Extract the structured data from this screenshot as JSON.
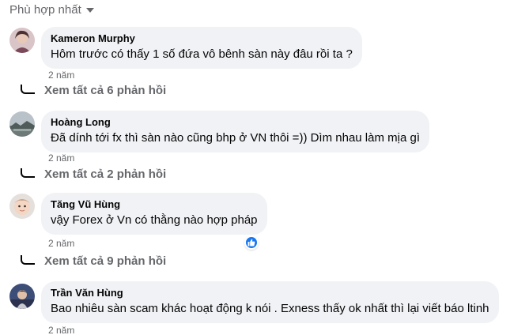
{
  "sort_label": "Phù hợp nhất",
  "comments": [
    {
      "author": "Kameron Murphy",
      "text": "Hôm trước có thấy 1 số đứa vô bênh sàn này đâu rồi ta ?",
      "time": "2 năm",
      "replies": "Xem tất cả 6 phản hồi"
    },
    {
      "author": "Hoàng Long",
      "text": "Đã dính tới fx thì sàn nào cũng bhp ở VN thôi =)) Dìm nhau làm mịa gì",
      "time": "2 năm",
      "replies": "Xem tất cả 2 phản hồi"
    },
    {
      "author": "Tăng Vũ Hùng",
      "text": "vậy Forex ở Vn có thằng nào hợp pháp",
      "time": "2 năm",
      "replies": "Xem tất cả 9 phản hồi"
    },
    {
      "author": "Trần Văn Hùng",
      "text": "Bao nhiêu sàn scam khác hoạt động k nói . Exness thấy ok nhất thì lại viết báo ltinh",
      "time": "2 năm"
    }
  ],
  "icons": {
    "sort": "chevron-down-icon",
    "like": "thumbs-up-icon",
    "reply_connector": "reply-connector-icon"
  },
  "colors": {
    "bubble": "#f0f2f5",
    "secondary_text": "#65676b",
    "like_blue": "#1877f2"
  }
}
